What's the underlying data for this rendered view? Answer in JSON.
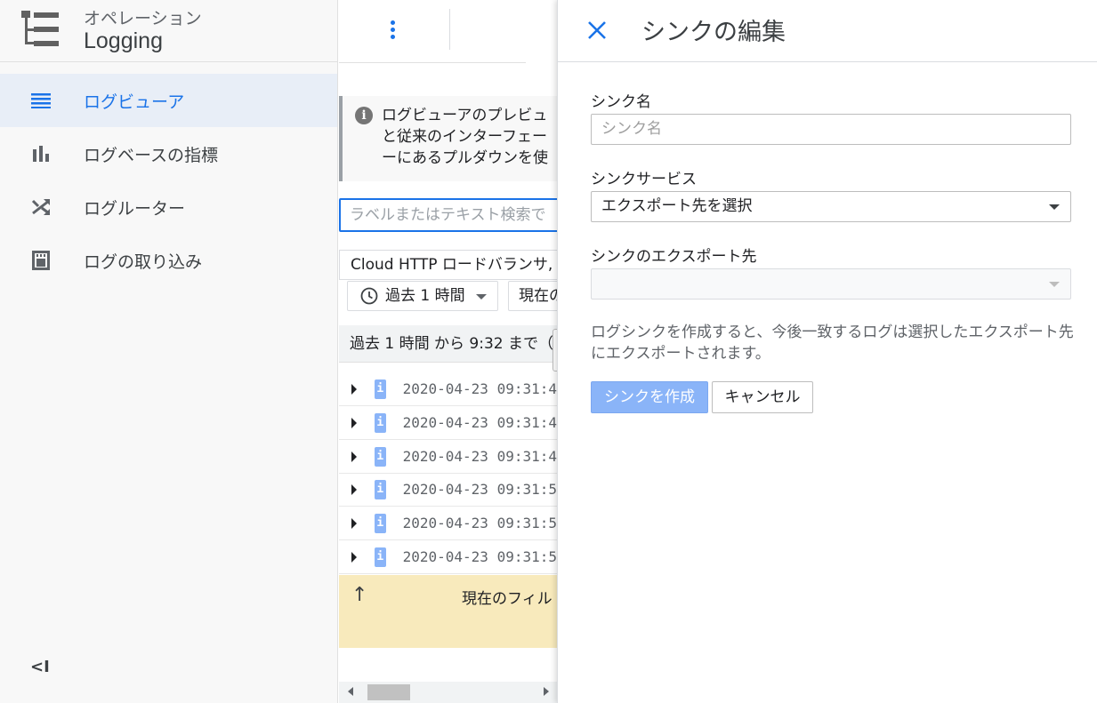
{
  "sidebar": {
    "product_group": "オペレーション",
    "product_name": "Logging",
    "items": [
      {
        "label": "ログビューア",
        "icon": "list-icon",
        "active": true
      },
      {
        "label": "ログベースの指標",
        "icon": "bar-chart-icon",
        "active": false
      },
      {
        "label": "ログルーター",
        "icon": "shuffle-icon",
        "active": false
      },
      {
        "label": "ログの取り込み",
        "icon": "storage-icon",
        "active": false
      }
    ],
    "collapse_label": "<I"
  },
  "viewer": {
    "info_text": "ログビューアのプレビュ\nと従来のインターフェー\nーにあるプルダウンを使",
    "search_placeholder": "ラベルまたはテキスト検索で",
    "resource_filter": "Cloud HTTP ロードバランサ,",
    "time_range": "過去 1 時間",
    "now_button": "現在の",
    "range_text": "過去 1 時間 から 9:32 まで（",
    "log_rows": [
      {
        "severity": "i",
        "timestamp": "2020-04-23 09:31:4"
      },
      {
        "severity": "i",
        "timestamp": "2020-04-23 09:31:4"
      },
      {
        "severity": "i",
        "timestamp": "2020-04-23 09:31:4"
      },
      {
        "severity": "i",
        "timestamp": "2020-04-23 09:31:5"
      },
      {
        "severity": "i",
        "timestamp": "2020-04-23 09:31:5"
      },
      {
        "severity": "i",
        "timestamp": "2020-04-23 09:31:5"
      }
    ],
    "filter_note": "現在のフィル"
  },
  "panel": {
    "title": "シンクの編集",
    "sink_name_label": "シンク名",
    "sink_name_placeholder": "シンク名",
    "sink_service_label": "シンクサービス",
    "sink_service_value": "エクスポート先を選択",
    "sink_destination_label": "シンクのエクスポート先",
    "sink_destination_value": "",
    "help_text": "ログシンクを作成すると、今後一致するログは選択したエクスポート先にエクスポートされます。",
    "create_button": "シンクを作成",
    "cancel_button": "キャンセル"
  },
  "colors": {
    "accent": "#1a73e8",
    "severity_info": "#8ab4f8",
    "primary_disabled": "#8ab4f8",
    "filter_note_bg": "#f8eabc"
  }
}
